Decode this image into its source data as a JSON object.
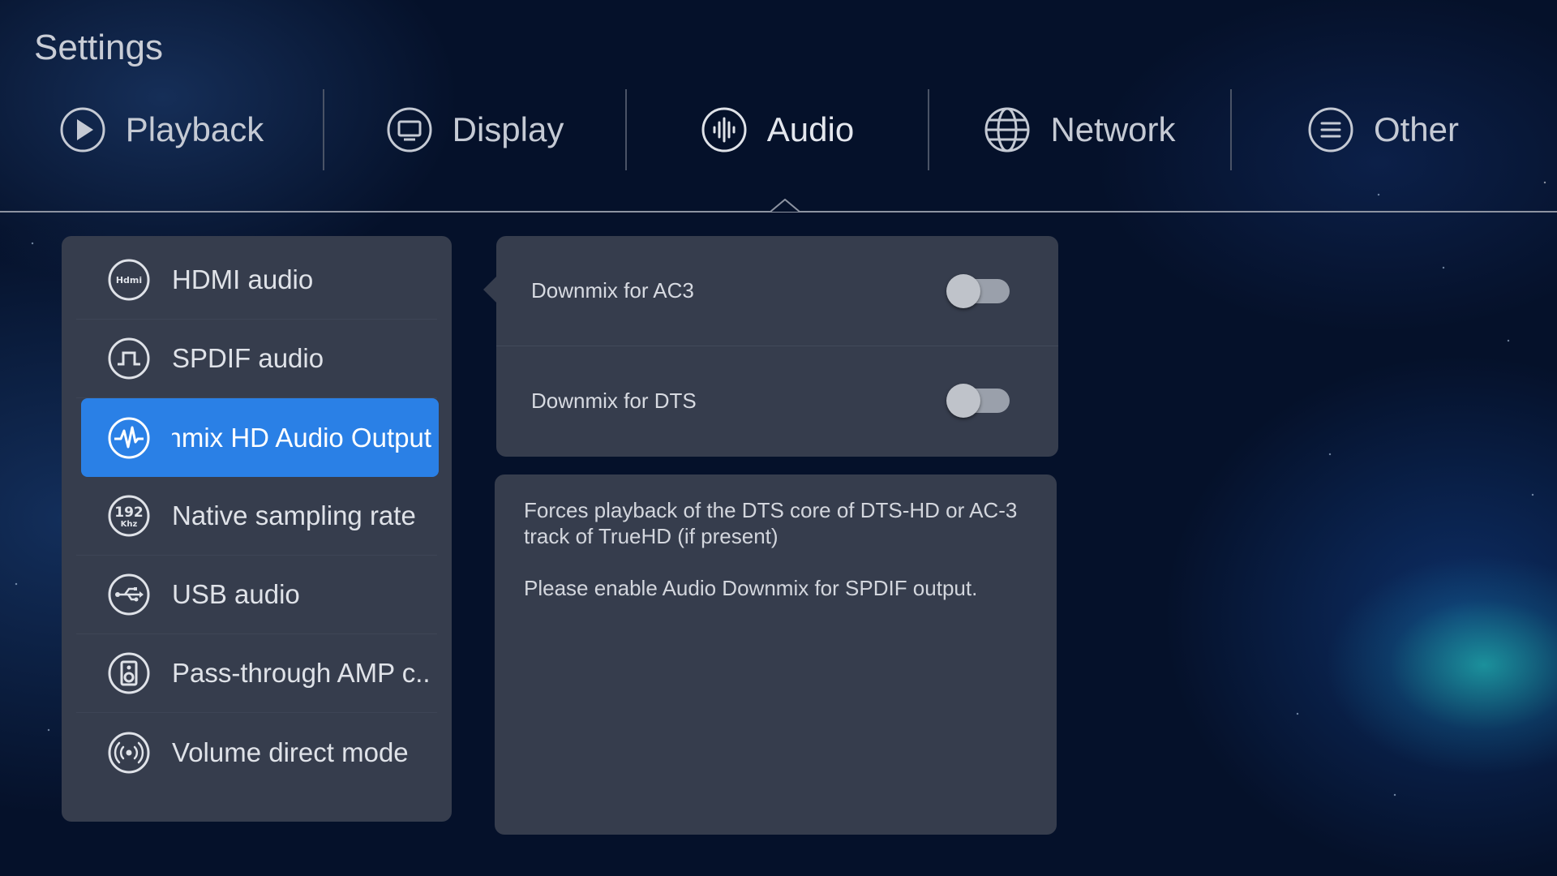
{
  "page": {
    "title": "Settings"
  },
  "tabs": [
    {
      "label": "Playback",
      "icon": "play-icon"
    },
    {
      "label": "Display",
      "icon": "display-icon"
    },
    {
      "label": "Audio",
      "icon": "audio-icon",
      "active": true
    },
    {
      "label": "Network",
      "icon": "globe-icon"
    },
    {
      "label": "Other",
      "icon": "menu-icon"
    }
  ],
  "menu": {
    "items": [
      {
        "label": "HDMI audio",
        "icon": "hdmi-icon"
      },
      {
        "label": "SPDIF audio",
        "icon": "spdif-icon"
      },
      {
        "label": "Downmix HD Audio Output",
        "icon": "waveform-icon",
        "selected": true
      },
      {
        "label": "Native sampling rate",
        "icon": "192khz-icon"
      },
      {
        "label": "USB audio",
        "icon": "usb-icon"
      },
      {
        "label": "Pass-through AMP c..",
        "icon": "speaker-icon"
      },
      {
        "label": "Volume direct mode",
        "icon": "broadcast-icon"
      }
    ]
  },
  "options": [
    {
      "label": "Downmix for AC3",
      "enabled": false
    },
    {
      "label": "Downmix for DTS",
      "enabled": false
    }
  ],
  "description": {
    "line1": "Forces playback of the DTS core of DTS-HD or AC-3 track of TrueHD (if present)",
    "line2": "Please enable Audio Downmix for SPDIF output."
  },
  "colors": {
    "accent": "#2a80e6",
    "panel": "#363d4d",
    "background": "#05112a"
  }
}
